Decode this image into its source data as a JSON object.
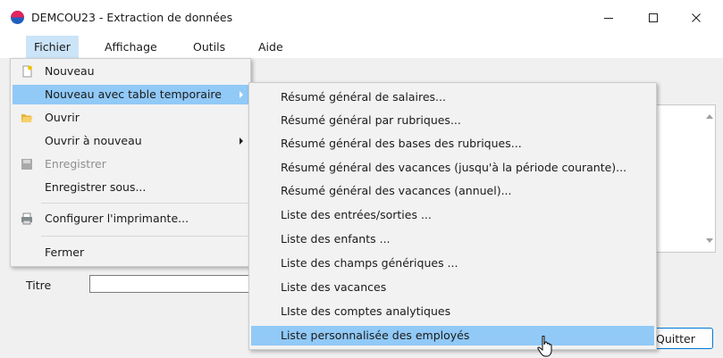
{
  "window": {
    "title": "DEMCOU23 - Extraction de données"
  },
  "menubar": [
    "Fichier",
    "Affichage",
    "Outils",
    "Aide"
  ],
  "file_menu": {
    "items": [
      {
        "label": "Nouveau",
        "icon": "new-document-icon"
      },
      {
        "label": "Nouveau avec table temporaire",
        "submenu": true,
        "selected": true
      },
      {
        "label": "Ouvrir",
        "icon": "open-folder-icon"
      },
      {
        "label": "Ouvrir à nouveau",
        "submenu": true
      },
      {
        "label": "Enregistrer",
        "icon": "save-disk-icon",
        "disabled": true
      },
      {
        "label": "Enregistrer sous..."
      },
      {
        "label": "Configurer l'imprimante...",
        "icon": "printer-icon"
      },
      {
        "label": "Fermer"
      }
    ]
  },
  "submenu": {
    "items": [
      "Résumé général de salaires...",
      "Résumé général par rubriques...",
      "Résumé général des bases des rubriques...",
      "Résumé général des vacances (jusqu'à la période courante)...",
      "Résumé général des vacances (annuel)...",
      "Liste des entrées/sorties ...",
      "Liste des enfants ...",
      "Liste des champs génériques ...",
      "Liste des vacances",
      "LIste des comptes analytiques",
      "Liste personnalisée des employés"
    ],
    "selected_index": 10
  },
  "form": {
    "titre_label": "Titre",
    "titre_value": "",
    "quit_label": "Quitter"
  },
  "colors": {
    "menu_highlight": "#91c9f7",
    "menubar_open": "#cce4f7",
    "button_border": "#0078d4"
  }
}
